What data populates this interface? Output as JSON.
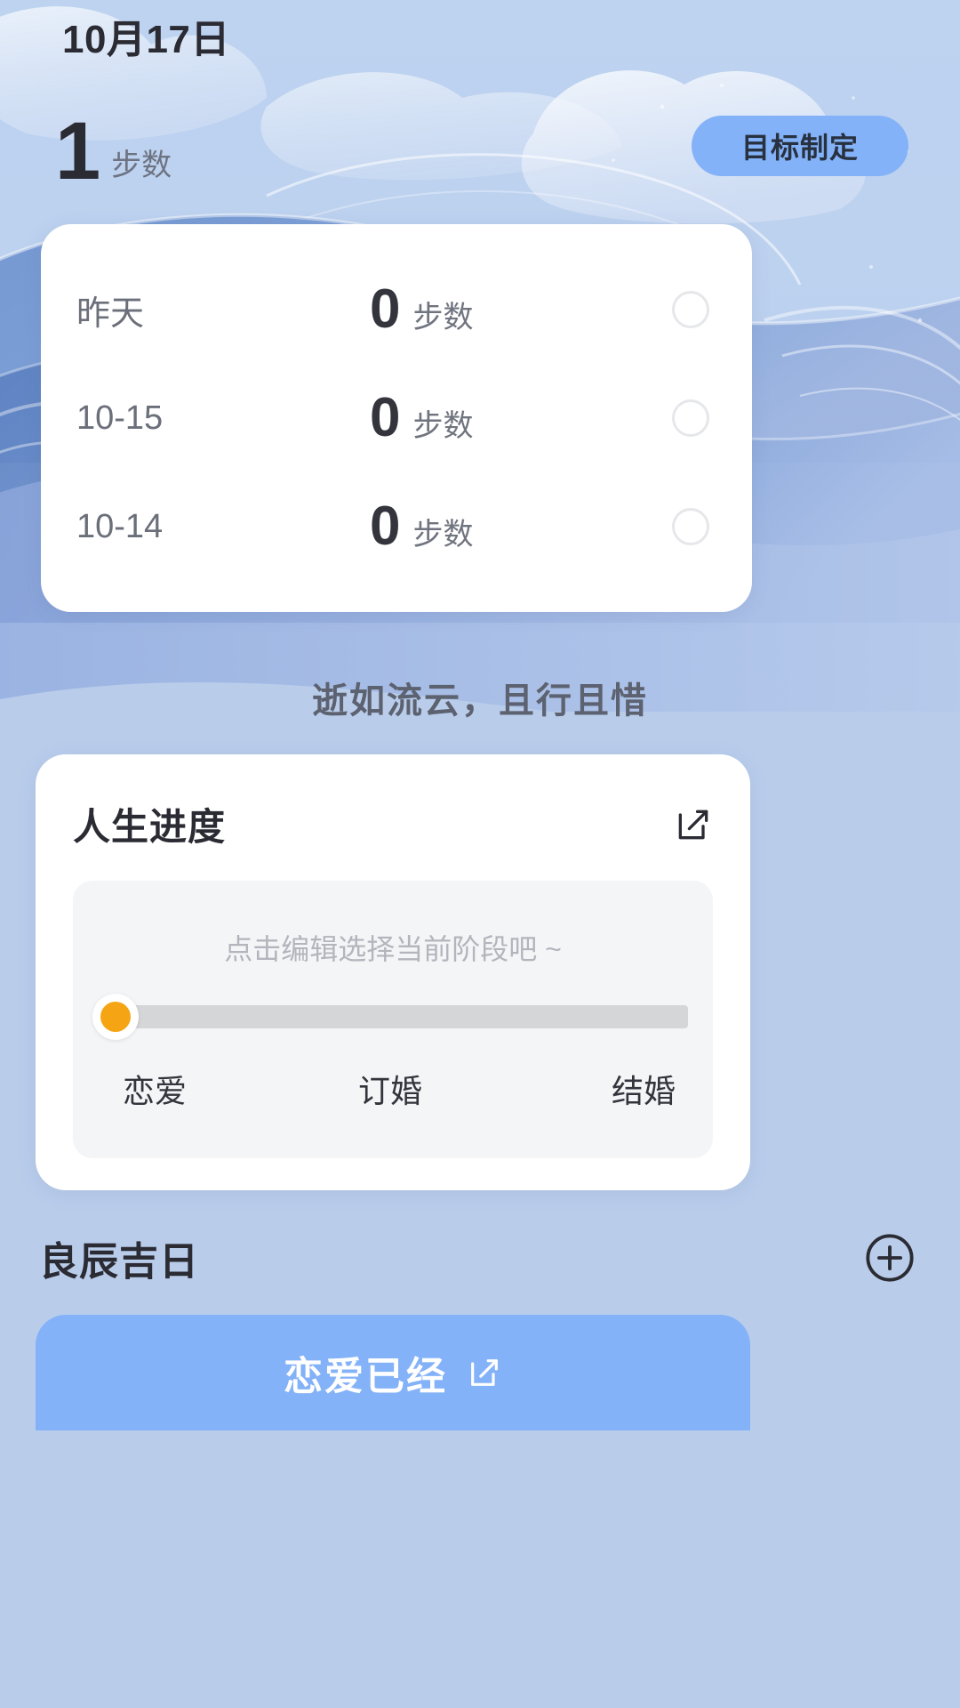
{
  "header": {
    "date": "10月17日",
    "goal_button": "目标制定"
  },
  "steps_today": {
    "count": "1",
    "unit": "步数"
  },
  "step_history": {
    "rows": [
      {
        "day": "昨天",
        "value": "0",
        "unit": "步数"
      },
      {
        "day": "10-15",
        "value": "0",
        "unit": "步数"
      },
      {
        "day": "10-14",
        "value": "0",
        "unit": "步数"
      }
    ]
  },
  "quote": "逝如流云，且行且惜",
  "life_progress": {
    "title": "人生进度",
    "edit_icon": "edit-square-icon",
    "hint": "点击编辑选择当前阶段吧 ~",
    "slider": {
      "value_percent": 0,
      "thumb_color": "#f5a514",
      "track_color": "#d5d6d8"
    },
    "stages": [
      "恋爱",
      "订婚",
      "结婚"
    ]
  },
  "auspicious": {
    "title": "良辰吉日",
    "add_icon": "plus-circle-icon"
  },
  "love_banner": {
    "text": "恋爱已经",
    "edit_icon": "edit-square-icon",
    "color": "#84b2f8"
  },
  "theme": {
    "background": "#b9cdeb",
    "accent_blue": "#84b2f8",
    "accent_orange": "#f5a514",
    "card_white": "#ffffff"
  }
}
